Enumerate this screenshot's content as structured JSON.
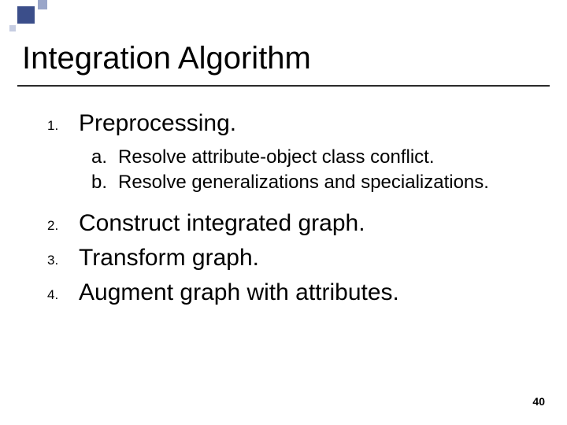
{
  "title": "Integration Algorithm",
  "items": [
    {
      "num": "1.",
      "text": "Preprocessing.",
      "sub": [
        {
          "lab": "a.",
          "text": "Resolve attribute-object class conflict."
        },
        {
          "lab": "b.",
          "text": "Resolve generalizations and specializations."
        }
      ]
    },
    {
      "num": "2.",
      "text": "Construct integrated graph."
    },
    {
      "num": "3.",
      "text": "Transform graph."
    },
    {
      "num": "4.",
      "text": "Augment graph with attributes."
    }
  ],
  "page_number": "40"
}
